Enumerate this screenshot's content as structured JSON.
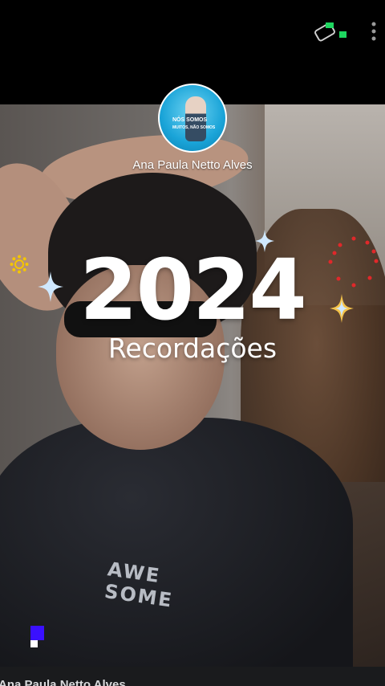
{
  "header": {
    "tag_icon": "tag-with-green-squares-icon",
    "menu_icon": "more-vertical-icon"
  },
  "profile": {
    "name": "Ana Paula Netto Alves",
    "avatar_caption_line1": "NÓS SOMOS",
    "avatar_caption_line2": "MUITOS, NÃO SOMOS"
  },
  "content": {
    "year": "2024",
    "subtitle": "Recordações",
    "shirt_text_line1": "AWE",
    "shirt_text_line2": "SOME"
  },
  "footer": {
    "name": "Ana Paula Netto Alves"
  },
  "colors": {
    "accent_green": "#1ed760",
    "sparkle_blue": "#cfe8ff",
    "sparkle_gold": "#f4c34a",
    "dots_red": "#e0282a",
    "pixel_blue": "#3a10ff"
  }
}
